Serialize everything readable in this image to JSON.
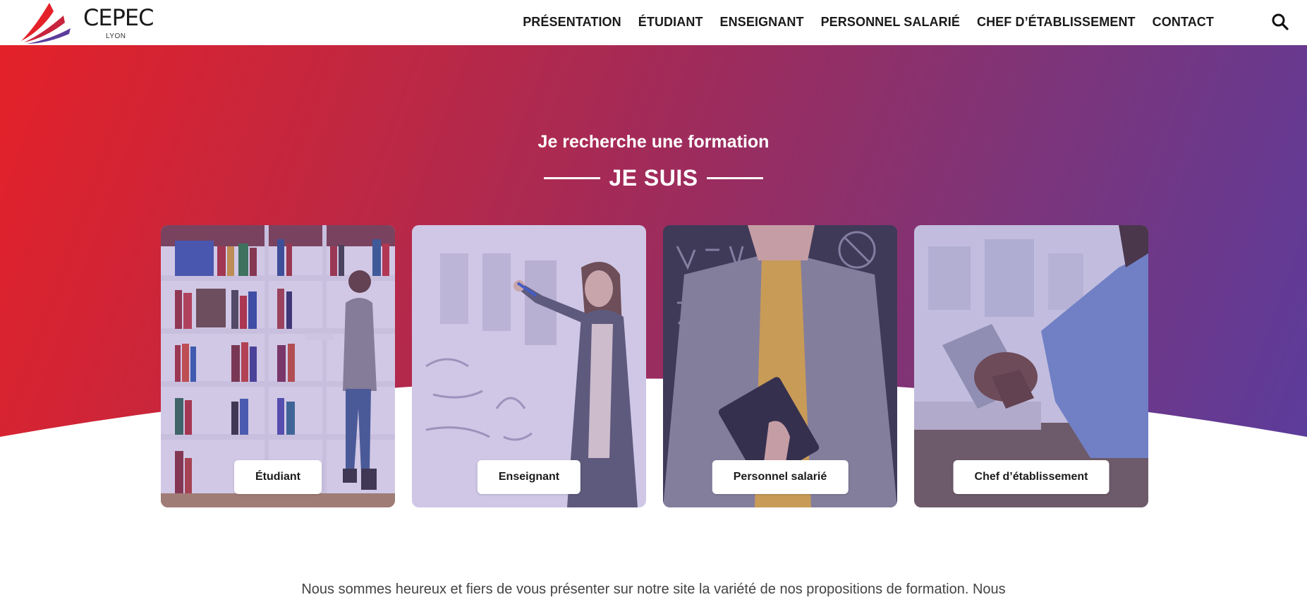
{
  "brand": {
    "name": "CEPEC",
    "city": "LYON"
  },
  "nav": {
    "items": [
      {
        "label": "PRÉSENTATION"
      },
      {
        "label": "ÉTUDIANT"
      },
      {
        "label": "ENSEIGNANT"
      },
      {
        "label": "PERSONNEL SALARIÉ"
      },
      {
        "label": "CHEF D’ÉTABLISSEMENT"
      },
      {
        "label": "CONTACT"
      }
    ],
    "search_icon": "search-icon"
  },
  "hero": {
    "subtitle": "Je recherche une formation",
    "title": "JE SUIS"
  },
  "cards": [
    {
      "label": "Étudiant",
      "image": "student-library-photo"
    },
    {
      "label": "Enseignant",
      "image": "teacher-whiteboard-photo"
    },
    {
      "label": "Personnel salarié",
      "image": "employee-notebook-photo"
    },
    {
      "label": "Chef d’établissement",
      "image": "manager-tablet-photo"
    }
  ],
  "intro": {
    "text": "Nous sommes heureux et fiers de vous présenter sur notre site la variété de nos propositions de formation. Nous"
  },
  "colors": {
    "gradient_start": "#e42129",
    "gradient_end": "#5b3c9c",
    "nav_text": "#1b1b1b"
  }
}
